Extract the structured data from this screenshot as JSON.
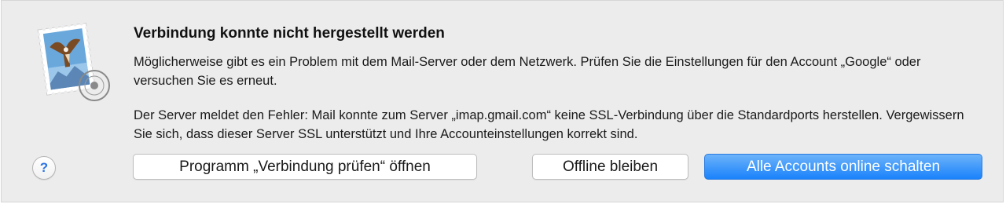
{
  "dialog": {
    "title": "Verbindung konnte nicht hergestellt werden",
    "message_line1": "Möglicherweise gibt es ein Problem mit dem Mail-Server oder dem Netzwerk. Prüfen Sie die Einstellungen für den Account „Google“ oder versuchen Sie es erneut.",
    "message_line2": "Der Server meldet den Fehler: Mail konnte zum Server „imap.gmail.com“ keine SSL-Verbindung über die Standardports herstellen. Vergewissern Sie sich, dass dieser Server SSL unterstützt und Ihre Accounteinstellungen korrekt sind.",
    "app_icon": "mail-stamp-icon"
  },
  "buttons": {
    "help_label": "?",
    "check_connection_label": "Programm „Verbindung prüfen“ öffnen",
    "stay_offline_label": "Offline bleiben",
    "all_online_label": "Alle Accounts online schalten"
  },
  "colors": {
    "dialog_background": "#ececec",
    "primary_button": "#1a82fb",
    "help_glyph": "#2d73e5"
  }
}
